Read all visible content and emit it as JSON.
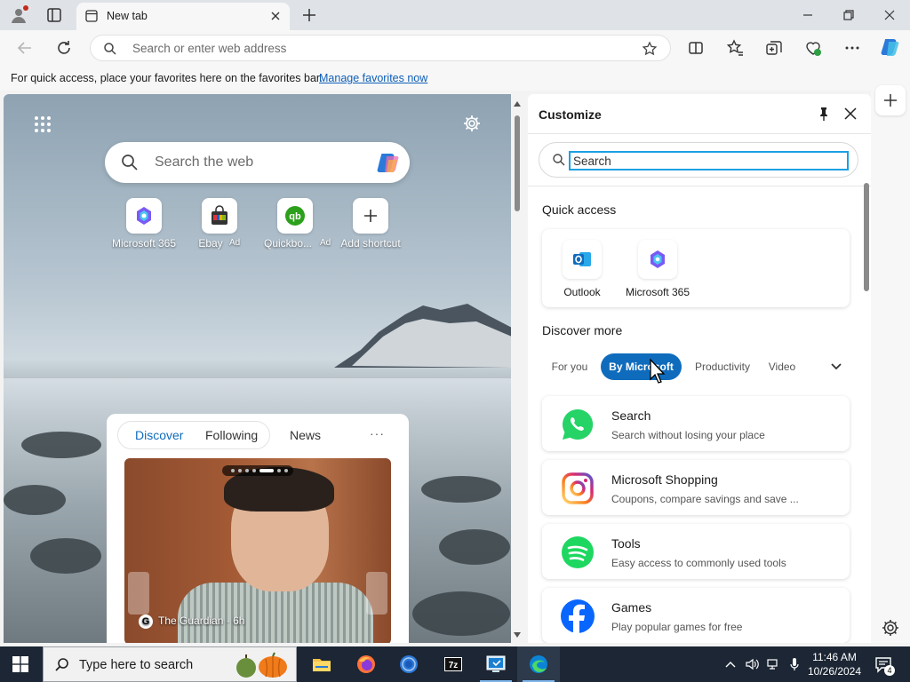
{
  "browser": {
    "tab_title": "New tab",
    "address_placeholder": "Search or enter web address",
    "favorites_message": "For quick access, place your favorites here on the favorites bar.",
    "favorites_link": "Manage favorites now"
  },
  "ntp": {
    "search_placeholder": "Search the web",
    "shortcuts": [
      {
        "label": "Microsoft 365",
        "ad": ""
      },
      {
        "label": "Ebay",
        "ad": "Ad"
      },
      {
        "label": "Quickbo...",
        "ad": "Ad"
      },
      {
        "label": "Add shortcut",
        "ad": ""
      }
    ],
    "feed_tabs": [
      "Discover",
      "Following",
      "News"
    ],
    "feed_more": "···",
    "article_source": "The Guardian",
    "article_time": "· 6h",
    "source_glyph": "G"
  },
  "customize": {
    "title": "Customize",
    "search_placeholder": "Search",
    "quick_access_title": "Quick access",
    "quick_access": [
      "Outlook",
      "Microsoft 365"
    ],
    "discover_title": "Discover more",
    "chips": [
      "For you",
      "By Microsoft",
      "Productivity",
      "Video"
    ],
    "items": [
      {
        "name": "Search",
        "desc": "Search without losing your place"
      },
      {
        "name": "Microsoft Shopping",
        "desc": "Coupons, compare savings and save ..."
      },
      {
        "name": "Tools",
        "desc": "Easy access to commonly used tools"
      },
      {
        "name": "Games",
        "desc": "Play popular games for free"
      }
    ]
  },
  "taskbar": {
    "search_placeholder": "Type here to search",
    "time": "11:46 AM",
    "date": "10/26/2024",
    "notification_count": "4"
  }
}
